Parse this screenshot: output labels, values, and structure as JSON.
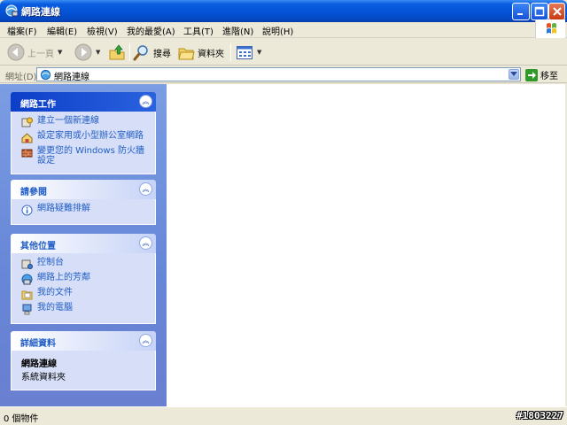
{
  "window": {
    "title": "網路連線",
    "controls": {
      "minimize": "minimize",
      "maximize": "maximize",
      "close": "close"
    }
  },
  "menu": {
    "items": [
      "檔案(F)",
      "編輯(E)",
      "檢視(V)",
      "我的最愛(A)",
      "工具(T)",
      "進階(N)",
      "說明(H)"
    ]
  },
  "toolbar": {
    "back": "上一頁",
    "search": "搜尋",
    "folders": "資料夾"
  },
  "address": {
    "label": "網址(D)",
    "value": "網路連線",
    "go": "移至"
  },
  "taskpane": {
    "network_tasks": {
      "title": "網路工作",
      "items": [
        "建立一個新連線",
        "設定家用或小型辦公室網路",
        "變更您的 Windows 防火牆設定"
      ]
    },
    "see_also": {
      "title": "請參閱",
      "items": [
        "網路疑難排解"
      ]
    },
    "other_places": {
      "title": "其他位置",
      "items": [
        "控制台",
        "網路上的芳鄰",
        "我的文件",
        "我的電腦"
      ]
    },
    "details": {
      "title": "詳細資料",
      "name": "網路連線",
      "type": "系統資料夾"
    }
  },
  "status": {
    "text": "0 個物件",
    "stamp": "#1803227"
  },
  "colors": {
    "titlebar": "#0553d6",
    "taskpane": "#6686d7",
    "link": "#215dc6",
    "panel_body": "#d6dff7"
  }
}
